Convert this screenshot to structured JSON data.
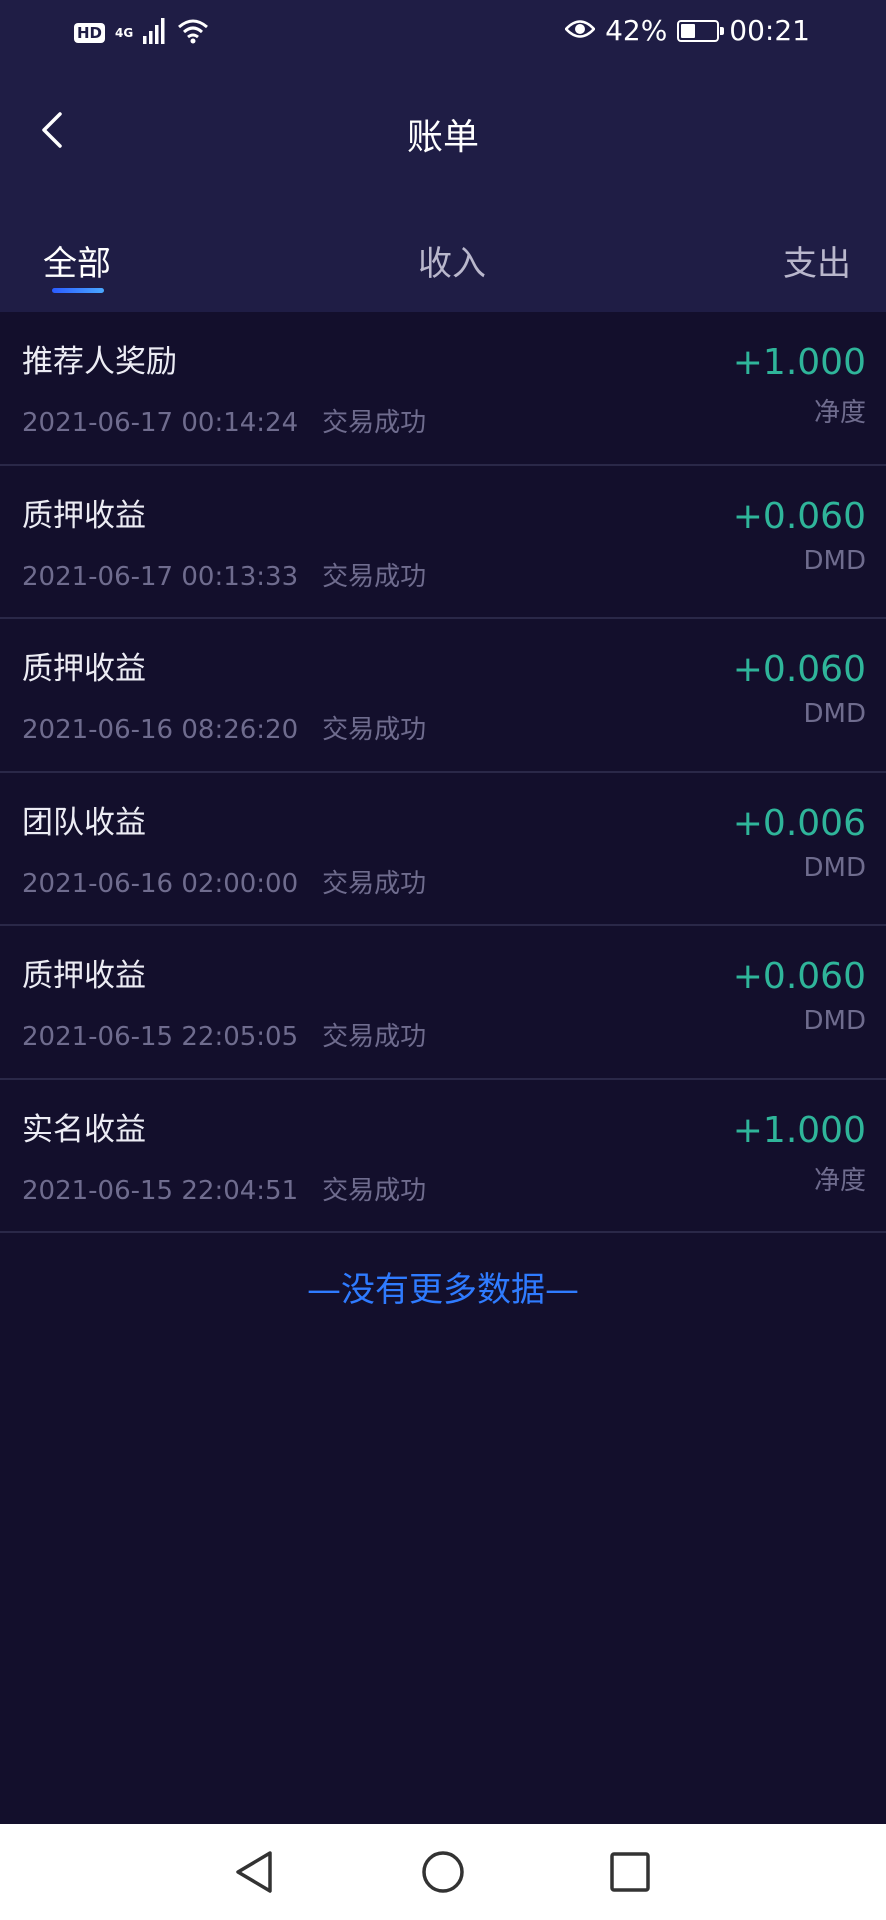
{
  "status_bar": {
    "hd": "HD",
    "network": "4G",
    "battery_percent": "42%",
    "battery_level": 0.42,
    "time": "00:21"
  },
  "header": {
    "title": "账单"
  },
  "tabs": [
    {
      "label": "全部",
      "active": true
    },
    {
      "label": "收入",
      "active": false
    },
    {
      "label": "支出",
      "active": false
    }
  ],
  "transactions": [
    {
      "title": "推荐人奖励",
      "datetime": "2021-06-17 00:14:24",
      "status": "交易成功",
      "amount": "+1.000",
      "unit": "净度"
    },
    {
      "title": "质押收益",
      "datetime": "2021-06-17 00:13:33",
      "status": "交易成功",
      "amount": "+0.060",
      "unit": "DMD"
    },
    {
      "title": "质押收益",
      "datetime": "2021-06-16 08:26:20",
      "status": "交易成功",
      "amount": "+0.060",
      "unit": "DMD"
    },
    {
      "title": "团队收益",
      "datetime": "2021-06-16 02:00:00",
      "status": "交易成功",
      "amount": "+0.006",
      "unit": "DMD"
    },
    {
      "title": "质押收益",
      "datetime": "2021-06-15 22:05:05",
      "status": "交易成功",
      "amount": "+0.060",
      "unit": "DMD"
    },
    {
      "title": "实名收益",
      "datetime": "2021-06-15 22:04:51",
      "status": "交易成功",
      "amount": "+1.000",
      "unit": "净度"
    }
  ],
  "footer_text": "—没有更多数据—",
  "colors": {
    "header_bg": "#1f1d45",
    "page_bg": "#130f2c",
    "amount_positive": "#2fb59a",
    "accent_blue": "#2f7bff"
  }
}
